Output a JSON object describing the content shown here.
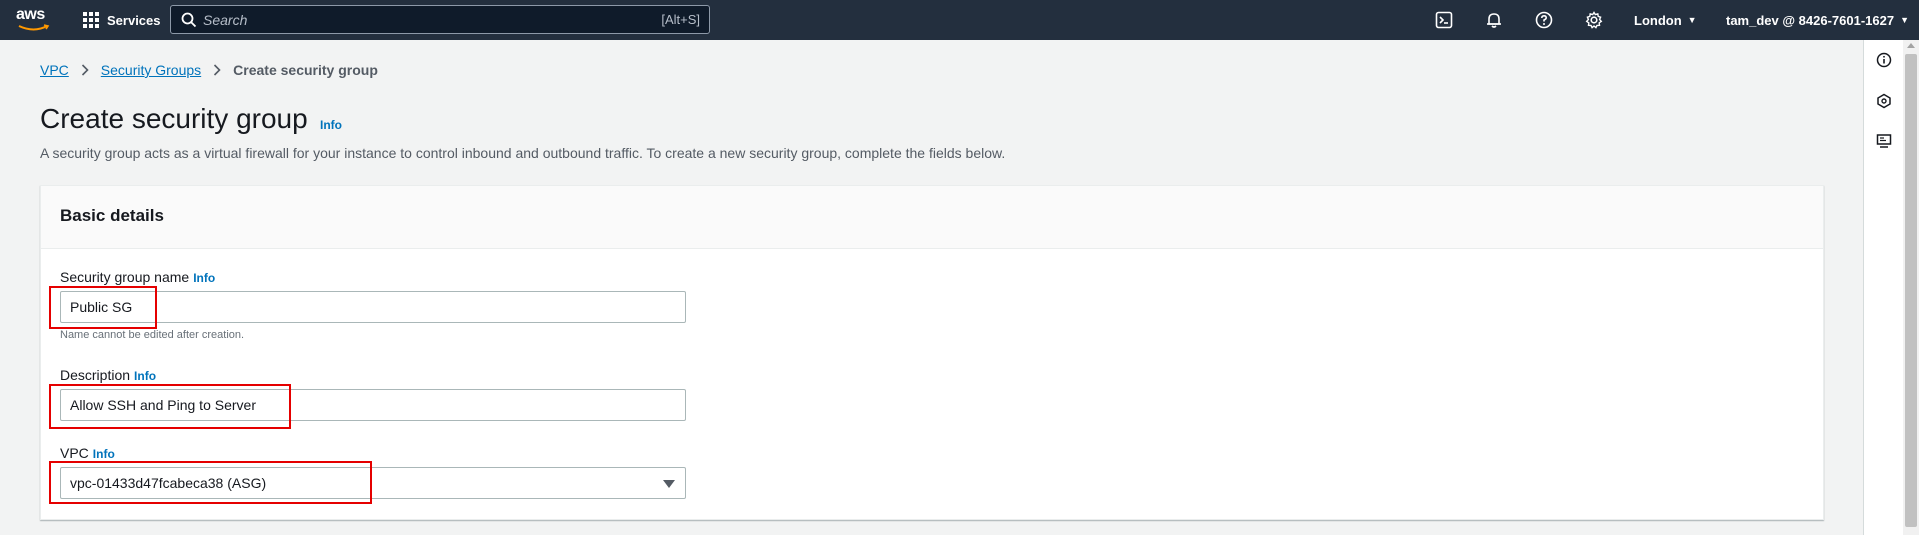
{
  "topnav": {
    "logo_text": "aws",
    "services_label": "Services",
    "search_placeholder": "Search",
    "search_shortcut": "[Alt+S]",
    "region": "London",
    "account": "tam_dev @ 8426-7601-1627"
  },
  "breadcrumb": {
    "items": [
      "VPC",
      "Security Groups"
    ],
    "current": "Create security group"
  },
  "page": {
    "title": "Create security group",
    "info": "Info",
    "description": "A security group acts as a virtual firewall for your instance to control inbound and outbound traffic. To create a new security group, complete the fields below."
  },
  "basic_details": {
    "title": "Basic details",
    "name_label": "Security group name",
    "name_info": "Info",
    "name_value": "Public SG",
    "name_hint": "Name cannot be edited after creation.",
    "desc_label": "Description",
    "desc_info": "Info",
    "desc_value": "Allow SSH and Ping to Server",
    "vpc_label": "VPC",
    "vpc_info": "Info",
    "vpc_value": "vpc-01433d47fcabeca38 (ASG)"
  },
  "colors": {
    "nav_bg": "#232f3e",
    "link": "#0073bb",
    "highlight": "#e50000",
    "page_bg": "#f2f3f3"
  }
}
